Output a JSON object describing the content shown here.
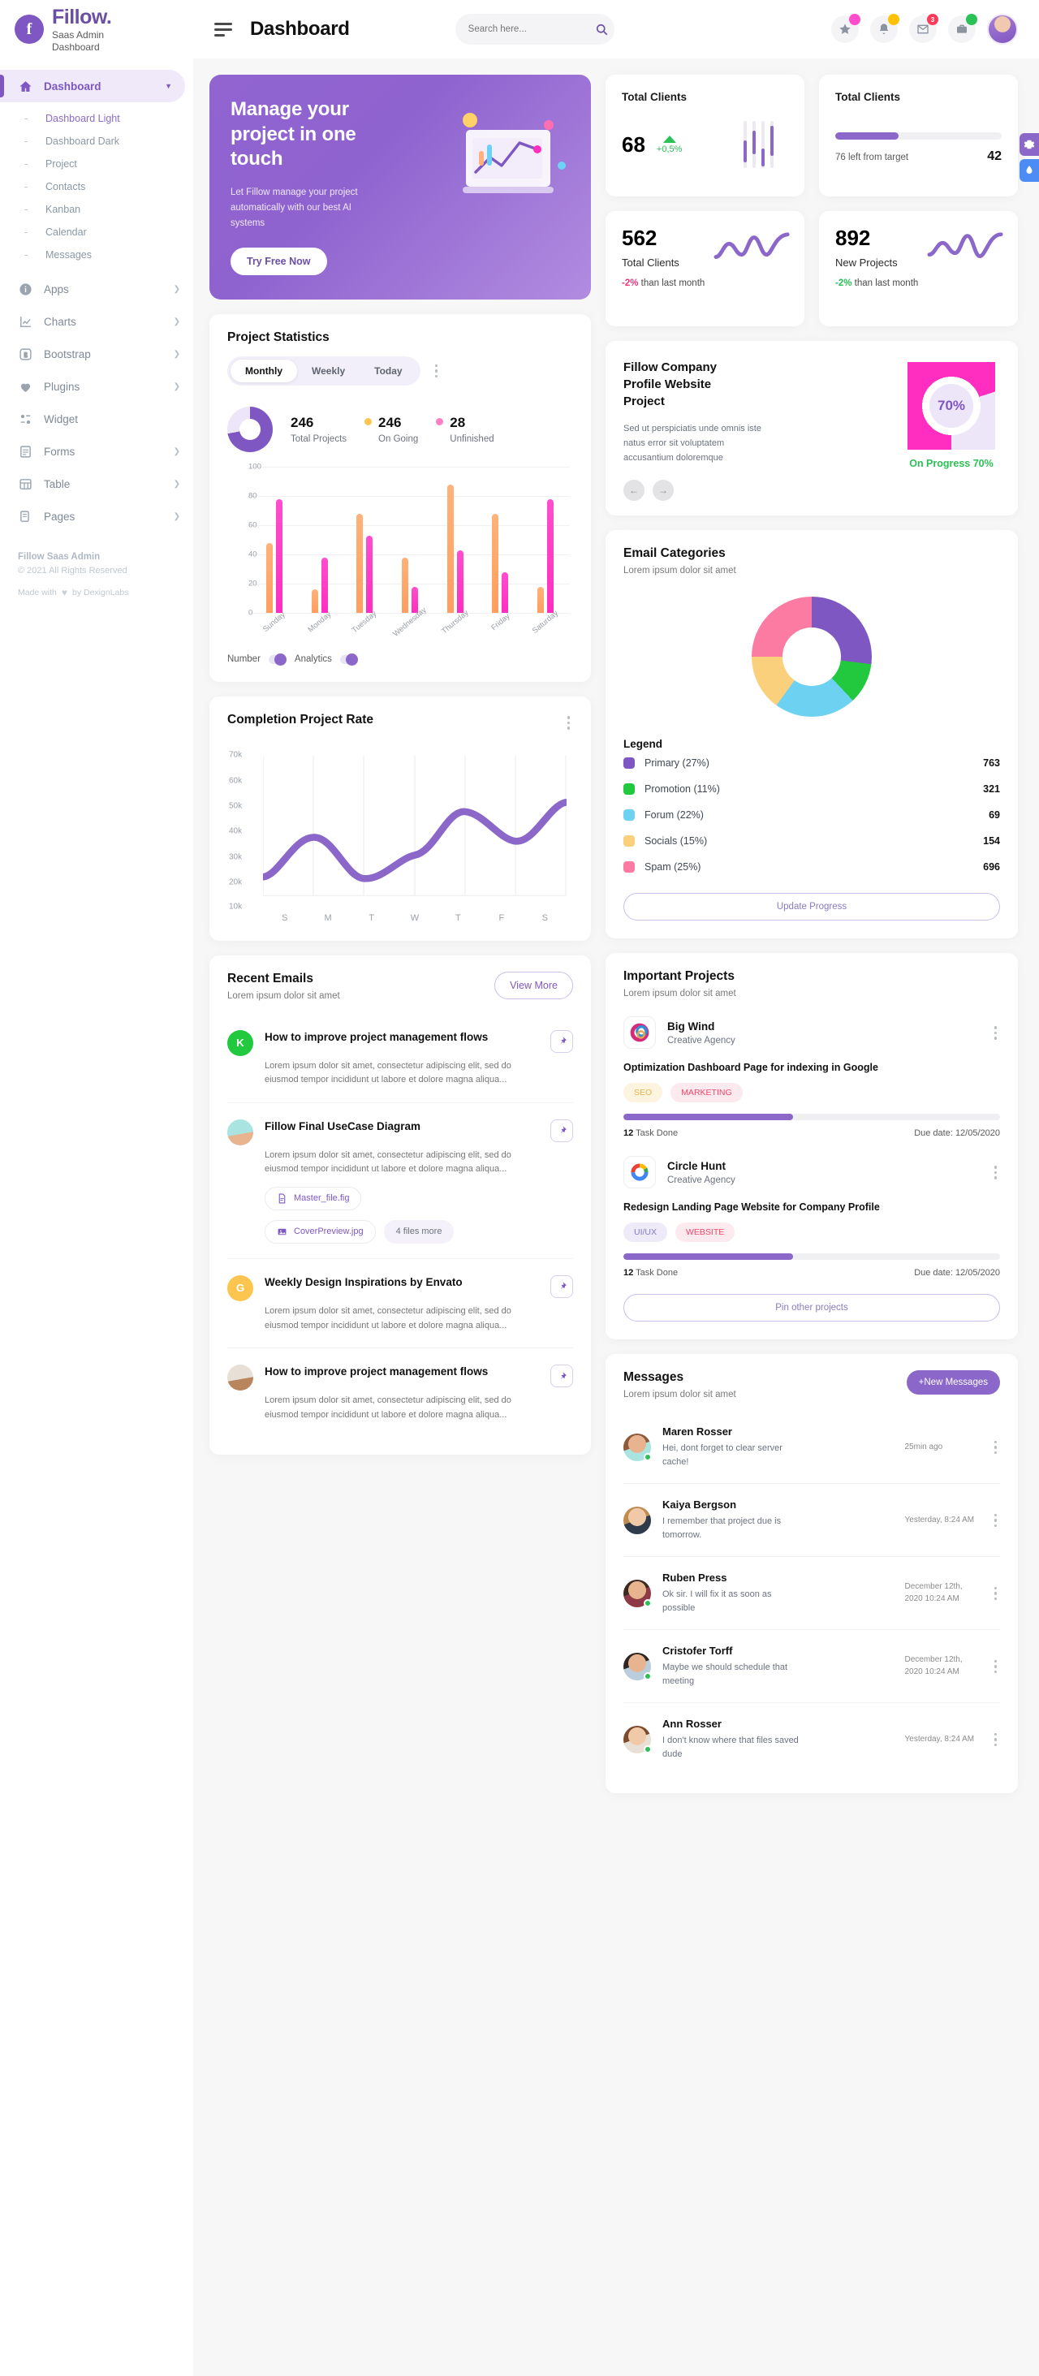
{
  "brand": {
    "name": "Fillow.",
    "sub1": "Saas Admin",
    "sub2": "Dashboard",
    "logo_letter": "f"
  },
  "sidebar": {
    "dashboard_label": "Dashboard",
    "sub_items": [
      {
        "label": "Dashboard Light"
      },
      {
        "label": "Dashboard Dark"
      },
      {
        "label": "Project"
      },
      {
        "label": "Contacts"
      },
      {
        "label": "Kanban"
      },
      {
        "label": "Calendar"
      },
      {
        "label": "Messages"
      }
    ],
    "items": [
      {
        "label": "Apps",
        "icon": "info-icon"
      },
      {
        "label": "Charts",
        "icon": "chart-icon"
      },
      {
        "label": "Bootstrap",
        "icon": "bootstrap-icon"
      },
      {
        "label": "Plugins",
        "icon": "heart-icon"
      },
      {
        "label": "Widget",
        "icon": "widget-icon"
      },
      {
        "label": "Forms",
        "icon": "forms-icon"
      },
      {
        "label": "Table",
        "icon": "table-icon"
      },
      {
        "label": "Pages",
        "icon": "pages-icon"
      }
    ],
    "footer": {
      "title": "Fillow Saas Admin",
      "copyright": "© 2021 All Rights Reserved",
      "made_prefix": "Made with",
      "made_suffix": "by DexignLabs"
    }
  },
  "header": {
    "title": "Dashboard",
    "search_placeholder": "Search here...",
    "icons": [
      {
        "name": "star-icon",
        "badge_color": "#ff4ecd"
      },
      {
        "name": "bell-icon",
        "badge_color": "#ffc107"
      },
      {
        "name": "envelope-icon",
        "badge": "3",
        "badge_color": "#ff3b5c"
      },
      {
        "name": "briefcase-icon",
        "badge_color": "#2bc155"
      }
    ]
  },
  "hero": {
    "title": "Manage your project in one touch",
    "text": "Let Fillow manage your project automatically with our best AI systems",
    "button": "Try Free Now"
  },
  "stats": {
    "clients_card": {
      "title": "Total Clients",
      "value": "68",
      "delta": "+0,5%",
      "bars": [
        42,
        58,
        30,
        78
      ]
    },
    "target_card": {
      "title": "Total Clients",
      "progress_percent": 38,
      "label": "76 left from target",
      "value": "42"
    },
    "total_clients": {
      "value": "562",
      "label": "Total Clients",
      "delta": "-2%",
      "delta_dir": "down",
      "suffix": "than last month"
    },
    "new_projects": {
      "value": "892",
      "label": "New Projects",
      "delta": "-2%",
      "delta_dir": "up",
      "suffix": "than last month"
    }
  },
  "project_statistics": {
    "title": "Project Statistics",
    "tabs": [
      {
        "label": "Monthly",
        "active": true
      },
      {
        "label": "Weekly",
        "active": false
      },
      {
        "label": "Today",
        "active": false
      }
    ],
    "summary": [
      {
        "value": "246",
        "label": "Total Projects",
        "color": "#7e57c2"
      },
      {
        "value": "246",
        "label": "On Going",
        "color": "#fbc550"
      },
      {
        "value": "28",
        "label": "Unfinished",
        "color": "#ff7ec6"
      }
    ],
    "legend": [
      {
        "label": "Number"
      },
      {
        "label": "Analytics"
      }
    ]
  },
  "completion_rate": {
    "title": "Completion Project Rate"
  },
  "chart_data": [
    {
      "type": "bar",
      "title": "Project Statistics",
      "categories": [
        "Sunday",
        "Monday",
        "Tuesday",
        "Wednesday",
        "Thursday",
        "Friday",
        "Saturday"
      ],
      "series": [
        {
          "name": "Number",
          "color": "#ff9e5e",
          "values": [
            48,
            16,
            68,
            38,
            88,
            68,
            18
          ]
        },
        {
          "name": "Analytics",
          "color": "#ff2ec0",
          "values": [
            78,
            38,
            53,
            18,
            43,
            28,
            78
          ]
        }
      ],
      "yticks": [
        0,
        20,
        40,
        60,
        80,
        100
      ],
      "ylim": [
        0,
        100
      ],
      "xlabel": "",
      "ylabel": "",
      "grid": true,
      "legend": "bottom"
    },
    {
      "type": "line",
      "title": "Completion Project Rate",
      "x": [
        "S",
        "M",
        "T",
        "W",
        "T",
        "F",
        "S"
      ],
      "values": [
        18000,
        40000,
        18500,
        29000,
        49500,
        38500,
        59000
      ],
      "yticks": [
        "10k",
        "20k",
        "30k",
        "40k",
        "50k",
        "60k",
        "70k"
      ],
      "ylim": [
        10000,
        70000
      ],
      "color": "#8a67c8",
      "grid": true,
      "legend": "none"
    },
    {
      "type": "pie",
      "title": "Email Categories",
      "labels": [
        "Primary (27%)",
        "Promotion (11%)",
        "Forum (22%)",
        "Socials (15%)",
        "Spam (25%)"
      ],
      "values": [
        27,
        11,
        22,
        15,
        25
      ],
      "counts": [
        763,
        321,
        69,
        154,
        696
      ],
      "colors": [
        "#7e57c2",
        "#22c93f",
        "#6dd2f2",
        "#fbd07c",
        "#fb7ba2"
      ],
      "legend": "bottom"
    },
    {
      "type": "pie",
      "title": "Fillow Company Profile Website Project",
      "labels": [
        "On Progress",
        "Remaining"
      ],
      "values": [
        70,
        30
      ],
      "colors": [
        "#ff2ec0",
        "#ece6f8"
      ],
      "center_label": "70%",
      "legend": "none"
    },
    {
      "type": "pie",
      "title": "Project Statistics Donut",
      "labels": [
        "Complete",
        "Remaining"
      ],
      "values": [
        72,
        28
      ],
      "colors": [
        "#7e57c2",
        "#ece6f8"
      ],
      "legend": "none"
    }
  ],
  "company_profile": {
    "title": "Fillow Company Profile Website Project",
    "text": "Sed ut perspiciatis unde omnis iste natus error sit voluptatem accusantium doloremque",
    "percent_center": "70%",
    "caption_prefix": "On Progress",
    "caption_value": "70%",
    "prev_icon": "arrow-left-icon",
    "next_icon": "arrow-right-icon"
  },
  "email_categories": {
    "title": "Email Categories",
    "subtitle": "Lorem ipsum dolor sit amet",
    "legend_title": "Legend",
    "items": [
      {
        "label": "Primary (27%)",
        "value": "763",
        "color": "#7e57c2"
      },
      {
        "label": "Promotion (11%)",
        "value": "321",
        "color": "#22c93f"
      },
      {
        "label": "Forum (22%)",
        "value": "69",
        "color": "#6dd2f2"
      },
      {
        "label": "Socials (15%)",
        "value": "154",
        "color": "#fbd07c"
      },
      {
        "label": "Spam (25%)",
        "value": "696",
        "color": "#fb7ba2"
      }
    ],
    "button": "Update Progress"
  },
  "recent_emails": {
    "title": "Recent Emails",
    "subtitle": "Lorem ipsum dolor sit amet",
    "view_more": "View More",
    "items": [
      {
        "avatar_letter": "K",
        "avatar_color": "#22c93f",
        "title": "How to improve project management flows",
        "body": "Lorem ipsum dolor sit amet, consectetur adipiscing elit, sed do\neiusmod tempor incididunt ut labore et dolore magna aliqua...",
        "attachments": []
      },
      {
        "avatar_letter": "",
        "avatar_color": "#c9a27a",
        "title": "Fillow Final UseCase Diagram",
        "body": "Lorem ipsum dolor sit amet, consectetur adipiscing elit, sed do\neiusmod tempor incididunt ut labore et dolore magna aliqua...",
        "attachments": [
          "Master_file.fig",
          "CoverPreview.jpg",
          "4 files more"
        ]
      },
      {
        "avatar_letter": "G",
        "avatar_color": "#fbc550",
        "title": "Weekly Design Inspirations by Envato",
        "body": "Lorem ipsum dolor sit amet, consectetur adipiscing elit, sed do\neiusmod tempor incididunt ut labore et dolore magna aliqua...",
        "attachments": []
      },
      {
        "avatar_letter": "",
        "avatar_color": "#b9855c",
        "title": "How to improve project management flows",
        "body": "Lorem ipsum dolor sit amet, consectetur adipiscing elit, sed do\neiusmod tempor incididunt ut labore et dolore magna aliqua...",
        "attachments": []
      }
    ]
  },
  "important_projects": {
    "title": "Important Projects",
    "subtitle": "Lorem ipsum dolor sit amet",
    "button": "Pin other projects",
    "items": [
      {
        "name": "Big Wind",
        "company": "Creative Agency",
        "task_title": "Optimization Dashboard Page for indexing in Google",
        "tags": [
          {
            "label": "SEO",
            "bg": "#fdf4e0",
            "color": "#e0b44e"
          },
          {
            "label": "MARKETING",
            "bg": "#fdeaee",
            "color": "#f0476b"
          }
        ],
        "progress": 45,
        "task_count": "12",
        "task_label": "Task Done",
        "due": "Due date: 12/05/2020"
      },
      {
        "name": "Circle Hunt",
        "company": "Creative Agency",
        "task_title": "Redesign Landing Page Website for Company Profile",
        "tags": [
          {
            "label": "UI/UX",
            "bg": "#efeaf8",
            "color": "#7e7bbf"
          },
          {
            "label": "WEBSITE",
            "bg": "#fdeaee",
            "color": "#f0476b"
          }
        ],
        "progress": 45,
        "task_count": "12",
        "task_label": "Task Done",
        "due": "Due date: 12/05/2020"
      }
    ]
  },
  "messages": {
    "title": "Messages",
    "subtitle": "Lorem ipsum dolor sit amet",
    "button": "+New Messages",
    "items": [
      {
        "name": "Maren Rosser",
        "text": "Hei, dont forget to clear server cache!",
        "time": "25min ago",
        "online": true,
        "skin": "#e8b48f",
        "hair": "#8d5a3b",
        "shirt": "#a9e4e0"
      },
      {
        "name": "Kaiya Bergson",
        "text": "I remember that project due is tomorrow.",
        "time": "Yesterday, 8:24 AM",
        "online": false,
        "skin": "#f0c9a8",
        "hair": "#c08b4f",
        "shirt": "#2f3b4a"
      },
      {
        "name": "Ruben Press",
        "text": "Ok sir. I will fix it as soon as possible",
        "time": "December 12th, 2020 10:24 AM",
        "online": true,
        "skin": "#e8b48f",
        "hair": "#3a2a22",
        "shirt": "#8e3a46"
      },
      {
        "name": "Cristofer Torff",
        "text": "Maybe we should schedule that meeting",
        "time": "December 12th, 2020 10:24 AM",
        "online": true,
        "skin": "#e8b48f",
        "hair": "#2e2622",
        "shirt": "#b9cddd"
      },
      {
        "name": "Ann Rosser",
        "text": "I don't know where that files saved dude",
        "time": "Yesterday, 8:24 AM",
        "online": true,
        "skin": "#f0c9a8",
        "hair": "#7a4b2c",
        "shirt": "#e8e0d6"
      }
    ]
  },
  "float_buttons": [
    {
      "name": "settings-icon",
      "color": "#8a67c8"
    },
    {
      "name": "droplet-icon",
      "color": "#4d8cf5"
    }
  ]
}
